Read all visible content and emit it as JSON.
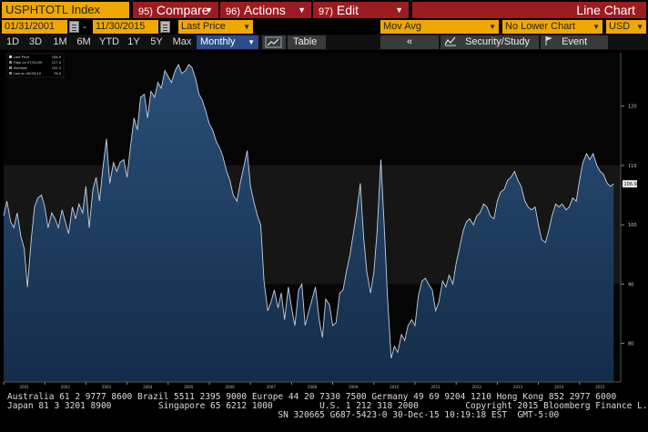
{
  "toolbar": {
    "ticker": "USPHTOTL Index",
    "compare": {
      "num": "95)",
      "label": "Compare"
    },
    "actions": {
      "num": "96)",
      "label": "Actions"
    },
    "edit": {
      "num": "97)",
      "label": "Edit"
    },
    "chart_title": "Line Chart"
  },
  "controls": {
    "start_date": "01/31/2001",
    "end_date": "11/30/2015",
    "price_field": "Last Price",
    "mov_avg": "Mov Avg",
    "lower_chart": "No Lower Chart",
    "currency": "USD"
  },
  "tabs": [
    "1D",
    "3D",
    "1M",
    "6M",
    "YTD",
    "1Y",
    "5Y",
    "Max"
  ],
  "period": "Monthly",
  "table_label": "Table",
  "back_label": "«",
  "security_study": "Security/Study",
  "event": "Event",
  "colors": {
    "accent": "#f0a800",
    "red": "#9c1c22",
    "area": "#1a3a5c",
    "line": "#c8d0e0"
  },
  "chart_data": {
    "type": "area",
    "legend": [
      {
        "label": "Last Price",
        "value": "106.9"
      },
      {
        "label": "High on 07/31/05",
        "value": "127.0"
      },
      {
        "label": "Average",
        "value": "102.3"
      },
      {
        "label": "Low on 06/30/10",
        "value": "76.4"
      }
    ],
    "last_value_label": "106.9",
    "y_ticks": [
      80,
      90,
      100,
      110,
      120
    ],
    "y_range": [
      73.5,
      129
    ],
    "x_ticks": [
      "2001",
      "2002",
      "2003",
      "2004",
      "2005",
      "2006",
      "2007",
      "2008",
      "2009",
      "2010",
      "2011",
      "2012",
      "2013",
      "2014",
      "2015"
    ],
    "x_range": [
      2001.0,
      2016.0
    ],
    "series": [
      {
        "points": [
          [
            2001.0,
            101.5
          ],
          [
            2001.08,
            104.0
          ],
          [
            2001.17,
            100.5
          ],
          [
            2001.25,
            99.5
          ],
          [
            2001.33,
            102.0
          ],
          [
            2001.42,
            98.0
          ],
          [
            2001.5,
            96.0
          ],
          [
            2001.58,
            89.5
          ],
          [
            2001.67,
            97.5
          ],
          [
            2001.75,
            103.0
          ],
          [
            2001.83,
            104.5
          ],
          [
            2001.92,
            105.0
          ],
          [
            2002.0,
            103.0
          ],
          [
            2002.08,
            99.5
          ],
          [
            2002.17,
            102.0
          ],
          [
            2002.25,
            101.0
          ],
          [
            2002.33,
            99.5
          ],
          [
            2002.42,
            102.5
          ],
          [
            2002.5,
            100.5
          ],
          [
            2002.58,
            98.5
          ],
          [
            2002.67,
            103.0
          ],
          [
            2002.75,
            101.0
          ],
          [
            2002.83,
            103.5
          ],
          [
            2002.92,
            102.0
          ],
          [
            2003.0,
            106.5
          ],
          [
            2003.08,
            99.5
          ],
          [
            2003.17,
            106.0
          ],
          [
            2003.25,
            108.0
          ],
          [
            2003.33,
            104.0
          ],
          [
            2003.42,
            110.0
          ],
          [
            2003.5,
            114.5
          ],
          [
            2003.58,
            107.0
          ],
          [
            2003.67,
            110.5
          ],
          [
            2003.75,
            109.0
          ],
          [
            2003.83,
            110.5
          ],
          [
            2003.92,
            111.0
          ],
          [
            2004.0,
            108.0
          ],
          [
            2004.08,
            113.0
          ],
          [
            2004.17,
            118.0
          ],
          [
            2004.25,
            116.0
          ],
          [
            2004.33,
            121.5
          ],
          [
            2004.42,
            122.0
          ],
          [
            2004.5,
            118.0
          ],
          [
            2004.58,
            122.5
          ],
          [
            2004.67,
            121.5
          ],
          [
            2004.75,
            124.0
          ],
          [
            2004.83,
            123.0
          ],
          [
            2004.92,
            126.0
          ],
          [
            2005.0,
            125.0
          ],
          [
            2005.08,
            124.0
          ],
          [
            2005.17,
            126.0
          ],
          [
            2005.25,
            127.0
          ],
          [
            2005.33,
            125.5
          ],
          [
            2005.42,
            126.0
          ],
          [
            2005.5,
            127.0
          ],
          [
            2005.58,
            126.5
          ],
          [
            2005.67,
            124.5
          ],
          [
            2005.75,
            122.0
          ],
          [
            2005.83,
            121.0
          ],
          [
            2005.92,
            119.0
          ],
          [
            2006.0,
            117.0
          ],
          [
            2006.08,
            116.0
          ],
          [
            2006.17,
            114.0
          ],
          [
            2006.25,
            113.0
          ],
          [
            2006.33,
            111.5
          ],
          [
            2006.42,
            109.0
          ],
          [
            2006.5,
            107.5
          ],
          [
            2006.58,
            105.0
          ],
          [
            2006.67,
            104.0
          ],
          [
            2006.75,
            107.0
          ],
          [
            2006.83,
            109.5
          ],
          [
            2006.92,
            112.5
          ],
          [
            2007.0,
            106.5
          ],
          [
            2007.08,
            104.0
          ],
          [
            2007.17,
            101.5
          ],
          [
            2007.25,
            100.0
          ],
          [
            2007.33,
            90.5
          ],
          [
            2007.42,
            85.5
          ],
          [
            2007.5,
            87.0
          ],
          [
            2007.58,
            89.0
          ],
          [
            2007.67,
            86.0
          ],
          [
            2007.75,
            88.5
          ],
          [
            2007.83,
            84.0
          ],
          [
            2007.92,
            89.5
          ],
          [
            2008.0,
            86.0
          ],
          [
            2008.08,
            83.0
          ],
          [
            2008.17,
            89.0
          ],
          [
            2008.25,
            90.0
          ],
          [
            2008.33,
            83.0
          ],
          [
            2008.42,
            85.5
          ],
          [
            2008.5,
            87.5
          ],
          [
            2008.58,
            89.5
          ],
          [
            2008.67,
            84.0
          ],
          [
            2008.75,
            81.0
          ],
          [
            2008.83,
            87.5
          ],
          [
            2008.92,
            86.5
          ],
          [
            2009.0,
            83.0
          ],
          [
            2009.08,
            83.5
          ],
          [
            2009.17,
            88.5
          ],
          [
            2009.25,
            89.0
          ],
          [
            2009.33,
            92.0
          ],
          [
            2009.42,
            95.0
          ],
          [
            2009.5,
            98.5
          ],
          [
            2009.58,
            102.0
          ],
          [
            2009.67,
            107.0
          ],
          [
            2009.75,
            98.0
          ],
          [
            2009.83,
            92.0
          ],
          [
            2009.92,
            88.5
          ],
          [
            2010.0,
            92.0
          ],
          [
            2010.08,
            99.0
          ],
          [
            2010.17,
            111.0
          ],
          [
            2010.25,
            100.0
          ],
          [
            2010.33,
            88.0
          ],
          [
            2010.42,
            77.5
          ],
          [
            2010.5,
            79.5
          ],
          [
            2010.58,
            78.5
          ],
          [
            2010.67,
            81.5
          ],
          [
            2010.75,
            80.5
          ],
          [
            2010.83,
            83.0
          ],
          [
            2010.92,
            84.0
          ],
          [
            2011.0,
            83.0
          ],
          [
            2011.08,
            88.0
          ],
          [
            2011.17,
            90.5
          ],
          [
            2011.25,
            91.0
          ],
          [
            2011.33,
            90.0
          ],
          [
            2011.42,
            89.0
          ],
          [
            2011.5,
            85.5
          ],
          [
            2011.58,
            87.0
          ],
          [
            2011.67,
            90.5
          ],
          [
            2011.75,
            89.5
          ],
          [
            2011.83,
            91.5
          ],
          [
            2011.92,
            90.0
          ],
          [
            2012.0,
            93.5
          ],
          [
            2012.08,
            96.0
          ],
          [
            2012.17,
            99.0
          ],
          [
            2012.25,
            100.5
          ],
          [
            2012.33,
            101.0
          ],
          [
            2012.42,
            100.0
          ],
          [
            2012.5,
            101.5
          ],
          [
            2012.58,
            102.0
          ],
          [
            2012.67,
            103.5
          ],
          [
            2012.75,
            103.0
          ],
          [
            2012.83,
            101.5
          ],
          [
            2012.92,
            101.0
          ],
          [
            2013.0,
            104.0
          ],
          [
            2013.08,
            105.5
          ],
          [
            2013.17,
            106.0
          ],
          [
            2013.25,
            107.5
          ],
          [
            2013.33,
            108.0
          ],
          [
            2013.42,
            109.0
          ],
          [
            2013.5,
            107.5
          ],
          [
            2013.58,
            106.5
          ],
          [
            2013.67,
            104.0
          ],
          [
            2013.75,
            103.0
          ],
          [
            2013.83,
            102.5
          ],
          [
            2013.92,
            103.0
          ],
          [
            2014.0,
            100.0
          ],
          [
            2014.08,
            97.5
          ],
          [
            2014.17,
            97.0
          ],
          [
            2014.25,
            99.0
          ],
          [
            2014.33,
            101.5
          ],
          [
            2014.42,
            103.5
          ],
          [
            2014.5,
            103.0
          ],
          [
            2014.58,
            103.5
          ],
          [
            2014.67,
            102.5
          ],
          [
            2014.75,
            103.0
          ],
          [
            2014.83,
            104.5
          ],
          [
            2014.92,
            104.0
          ],
          [
            2015.0,
            107.5
          ],
          [
            2015.08,
            110.5
          ],
          [
            2015.17,
            112.0
          ],
          [
            2015.25,
            111.0
          ],
          [
            2015.33,
            112.0
          ],
          [
            2015.42,
            110.0
          ],
          [
            2015.5,
            109.0
          ],
          [
            2015.58,
            108.5
          ],
          [
            2015.67,
            107.0
          ],
          [
            2015.75,
            106.5
          ],
          [
            2015.83,
            106.9
          ]
        ]
      }
    ]
  },
  "footer": {
    "line1": "Australia 61 2 9777 8600 Brazil 5511 2395 9000 Europe 44 20 7330 7500 Germany 49 69 9204 1210 Hong Kong 852 2977 6000",
    "line2": "Japan 81 3 3201 8900         Singapore 65 6212 1000         U.S. 1 212 318 2000         Copyright 2015 Bloomberg Finance L.P.",
    "line3": "                                                    SN 320665 G687-5423-0 30-Dec-15 10:19:18 EST  GMT-5:00"
  }
}
